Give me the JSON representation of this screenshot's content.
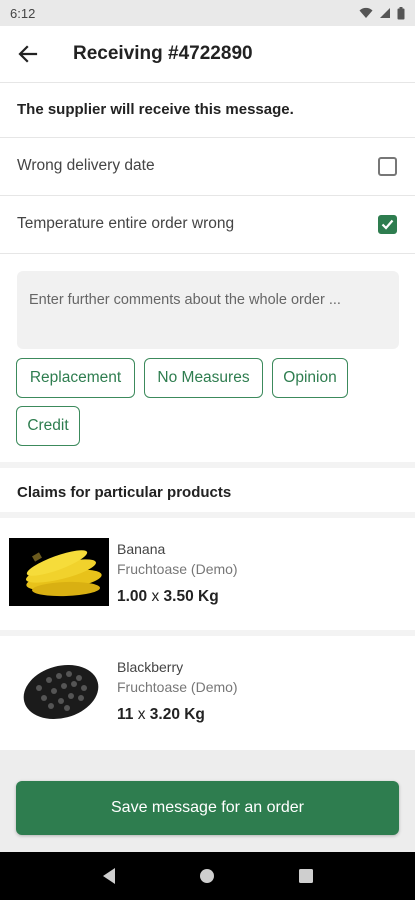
{
  "status_bar": {
    "time": "6:12"
  },
  "app_bar": {
    "title": "Receiving #4722890"
  },
  "info_text": "The supplier will receive this message.",
  "reasons": [
    {
      "label": "Wrong delivery date",
      "checked": false
    },
    {
      "label": "Temperature entire order wrong",
      "checked": true
    }
  ],
  "comment": {
    "placeholder": "Enter further comments about the whole order ...",
    "value": ""
  },
  "measures": [
    "Replacement",
    "No Measures",
    "Opinion",
    "Credit"
  ],
  "products_section": {
    "title": "Claims for particular products"
  },
  "products": [
    {
      "name": "Banana",
      "supplier": "Fruchtoase (Demo)",
      "quantity": "1.00",
      "times": "x",
      "price_unit": "3.50 Kg"
    },
    {
      "name": "Blackberry",
      "supplier": "Fruchtoase (Demo)",
      "quantity": "11",
      "times": "x",
      "price_unit": "3.20 Kg"
    }
  ],
  "save_button": {
    "label": "Save message for an order"
  },
  "colors": {
    "accent": "#2e7d4f",
    "status_bar": "#e9e9e9",
    "nav_bar": "#000000"
  }
}
